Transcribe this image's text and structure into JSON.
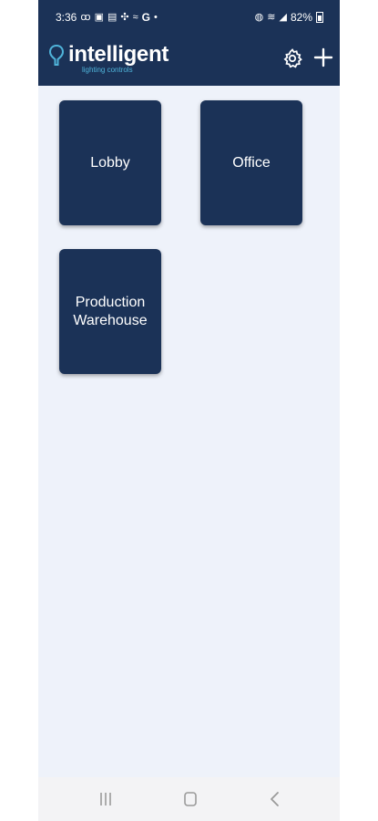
{
  "status_bar": {
    "time": "3:36",
    "left_icons": [
      "voicemail-icon",
      "photo-icon",
      "news-icon",
      "fan-icon",
      "wind-icon",
      "google-icon",
      "dot-icon"
    ],
    "google_glyph": "G",
    "battery": "82%",
    "right_icons": [
      "alarm-icon",
      "wifi-icon",
      "signal-icon",
      "battery-icon"
    ]
  },
  "header": {
    "brand_title": "intelligent",
    "brand_subtitle": "lighting controls",
    "settings_icon": "gear-icon",
    "add_icon": "plus-icon"
  },
  "rooms": [
    {
      "label": "Lobby"
    },
    {
      "label": "Office"
    },
    {
      "label": "Production Warehouse"
    }
  ],
  "nav_bar": {
    "buttons": [
      "recent-apps-icon",
      "home-icon",
      "back-icon"
    ]
  },
  "colors": {
    "header_bg": "#1b3257",
    "tile_bg": "#1b3257",
    "page_bg": "#eef2fa",
    "accent": "#4fb3d9"
  }
}
